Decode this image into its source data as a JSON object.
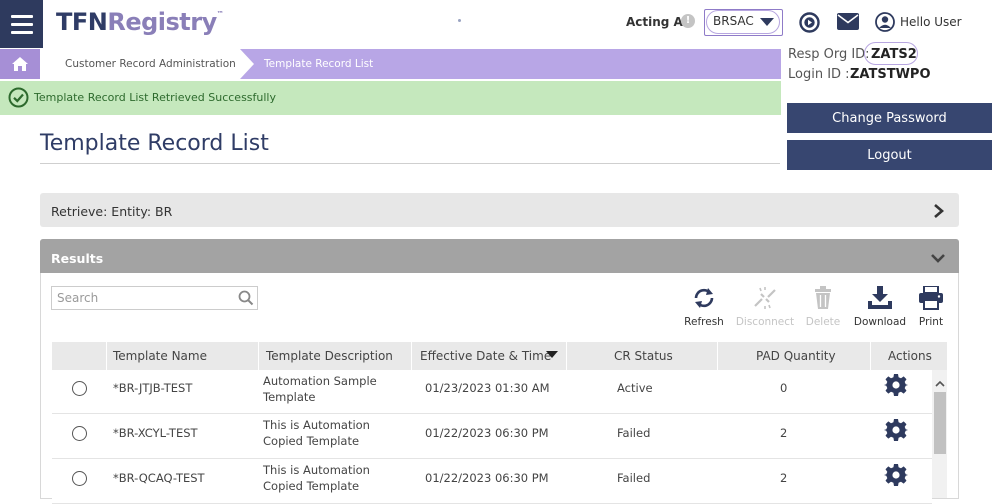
{
  "header": {
    "logo_part1": "TFN",
    "logo_part2": "Registry",
    "logo_tm": "™",
    "acting_as_label": "Acting As",
    "acting_as_value": "BRSAC",
    "greeting": "Hello User"
  },
  "breadcrumb": {
    "items": [
      {
        "label": "Customer Record Administration"
      },
      {
        "label": "Template Record List"
      }
    ]
  },
  "notification": {
    "message": "Template Record List Retrieved Successfully",
    "color": "#c5e8bd"
  },
  "user_panel": {
    "resp_org_label": "Resp Org ID:",
    "resp_org_value": "ZATS2",
    "login_id_label": "Login ID :",
    "login_id_value": "ZATSTWPO",
    "change_password_label": "Change Password",
    "logout_label": "Logout"
  },
  "page": {
    "title": "Template Record List"
  },
  "retrieve": {
    "label": "Retrieve: Entity: BR"
  },
  "results": {
    "label": "Results",
    "search_placeholder": "Search",
    "toolbar": {
      "refresh": "Refresh",
      "disconnect": "Disconnect",
      "delete": "Delete",
      "download": "Download",
      "print": "Print"
    },
    "columns": [
      "Template Name",
      "Template Description",
      "Effective Date & Time",
      "CR Status",
      "PAD Quantity",
      "Actions"
    ],
    "rows": [
      {
        "name": "*BR-JTJB-TEST",
        "desc_line1": "Automation Sample",
        "desc_line2": "Template",
        "date": "01/23/2023 01:30 AM",
        "status": "Active",
        "pad": "0"
      },
      {
        "name": "*BR-XCYL-TEST",
        "desc_line1": "This is Automation",
        "desc_line2": "Copied Template",
        "date": "01/22/2023 06:30 PM",
        "status": "Failed",
        "pad": "2"
      },
      {
        "name": "*BR-QCAQ-TEST",
        "desc_line1": "This is Automation",
        "desc_line2": "Copied Template",
        "date": "01/22/2023 06:30 PM",
        "status": "Failed",
        "pad": "2"
      }
    ]
  },
  "colors": {
    "brand_navy": "#2e3a5e",
    "brand_purple": "#b8a6e6",
    "button_navy": "#374670"
  }
}
